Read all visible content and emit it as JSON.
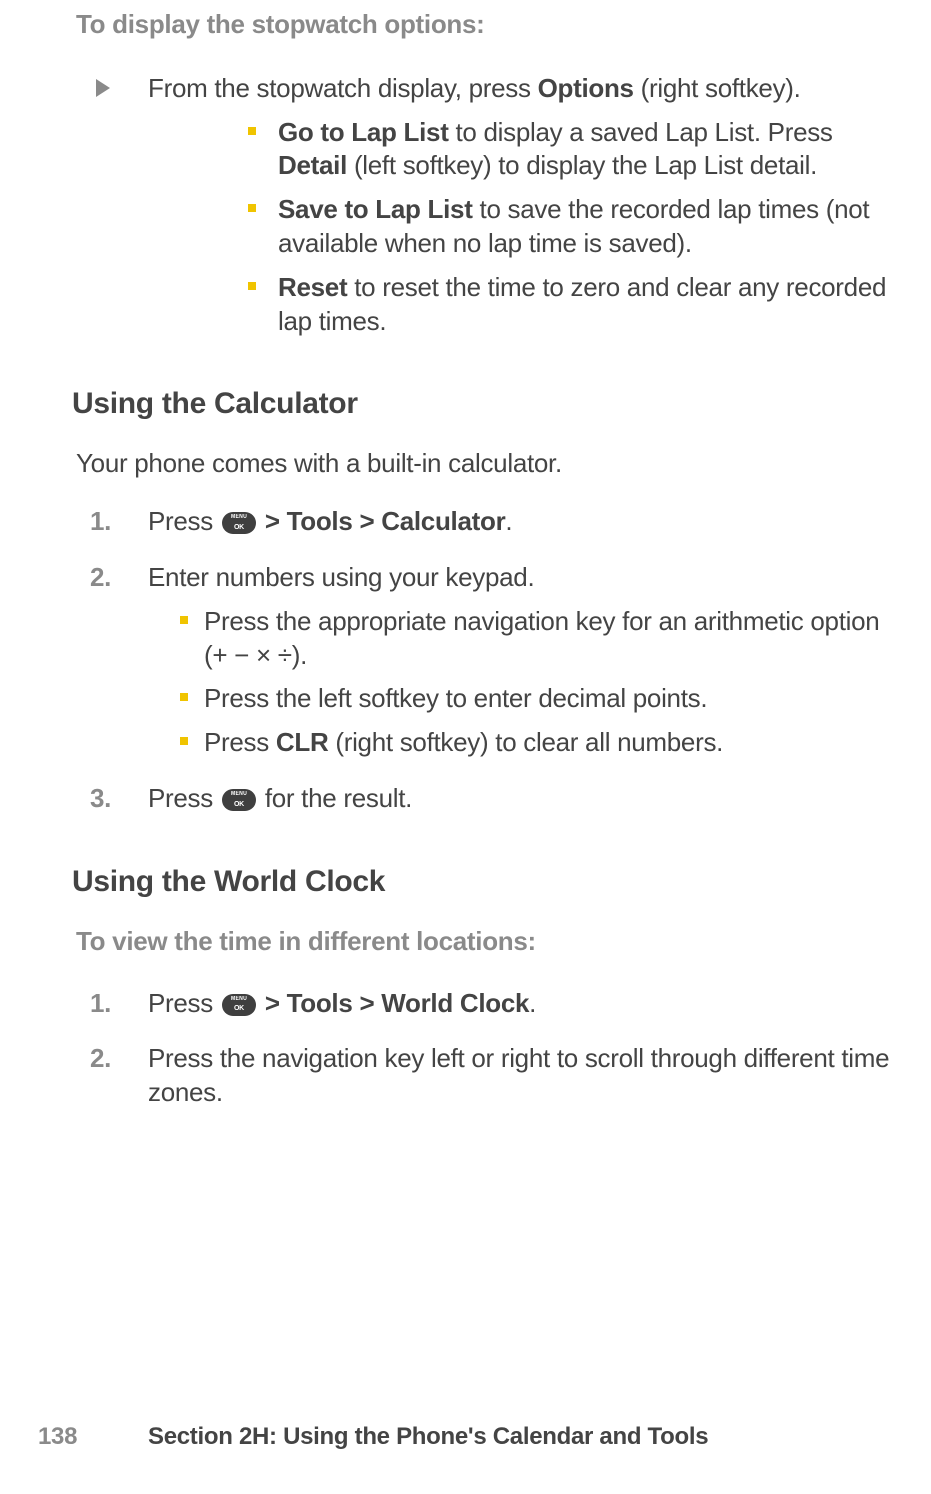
{
  "stopwatch": {
    "subheading": "To display the stopwatch options:",
    "intro_prefix": "From the stopwatch display, press ",
    "intro_bold": "Options",
    "intro_suffix": " (right softkey).",
    "items": [
      {
        "bold": "Go to Lap List",
        "text_prefix": " to display a saved Lap List. Press ",
        "bold2": "Detail",
        "text_suffix": " (left softkey) to display the Lap List detail."
      },
      {
        "bold": "Save to Lap List",
        "text_prefix": " to save the recorded lap times (not available when no lap time is saved).",
        "bold2": "",
        "text_suffix": ""
      },
      {
        "bold": "Reset",
        "text_prefix": " to reset the time to zero and clear any recorded lap times.",
        "bold2": "",
        "text_suffix": ""
      }
    ]
  },
  "calculator": {
    "heading": "Using the Calculator",
    "intro": "Your phone comes with a built-in calculator.",
    "step1_pre": "Press ",
    "step1_path": " > Tools > Calculator",
    "step1_end": ".",
    "step2": "Enter numbers using your keypad.",
    "sub": [
      "Press the appropriate navigation key for an arithmetic option (+ − × ÷).",
      "Press the left softkey to enter decimal points."
    ],
    "sub3_pre": "Press ",
    "sub3_bold": "CLR",
    "sub3_post": " (right softkey) to clear all numbers.",
    "step3_pre": "Press ",
    "step3_post": " for the result."
  },
  "worldclock": {
    "heading": "Using the World Clock",
    "subheading": "To view the time in different locations:",
    "step1_pre": "Press ",
    "step1_path": " > Tools > World Clock",
    "step1_end": ".",
    "step2": "Press the navigation key left or right to scroll through different time zones."
  },
  "footer": {
    "page_number": "138",
    "text": "Section 2H: Using the Phone's Calendar and Tools"
  }
}
